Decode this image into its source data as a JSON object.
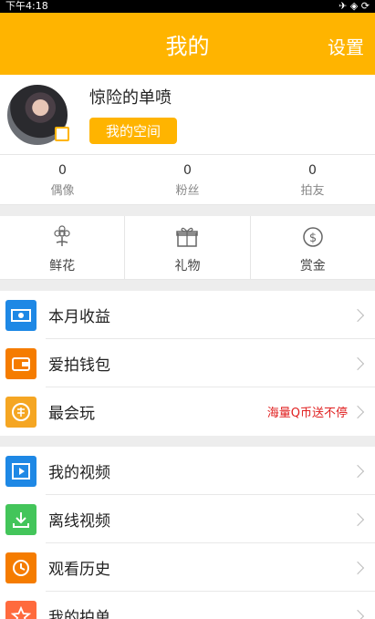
{
  "status": {
    "time": "下午4:18",
    "icons": "✈ ◈ ⟳"
  },
  "header": {
    "title": "我的",
    "settings": "设置"
  },
  "profile": {
    "name": "惊险的单喷",
    "space_button": "我的空间"
  },
  "stats": [
    {
      "value": "0",
      "label": "偶像"
    },
    {
      "value": "0",
      "label": "粉丝"
    },
    {
      "value": "0",
      "label": "拍友"
    }
  ],
  "gifts": [
    {
      "label": "鲜花",
      "icon": "flower-icon"
    },
    {
      "label": "礼物",
      "icon": "gift-icon"
    },
    {
      "label": "赏金",
      "icon": "coin-icon"
    }
  ],
  "menu1": [
    {
      "label": "本月收益",
      "icon": "income-icon",
      "color": "#1e88e5"
    },
    {
      "label": "爱拍钱包",
      "icon": "wallet-icon",
      "color": "#f57c00"
    },
    {
      "label": "最会玩",
      "icon": "medal-icon",
      "color": "#f5a623",
      "extra": "海量Q币送不停"
    }
  ],
  "menu2": [
    {
      "label": "我的视频",
      "icon": "video-icon",
      "color": "#1e88e5"
    },
    {
      "label": "离线视频",
      "icon": "download-icon",
      "color": "#43c55a"
    },
    {
      "label": "观看历史",
      "icon": "clock-icon",
      "color": "#f57c00"
    },
    {
      "label": "我的拍单",
      "icon": "star-icon",
      "color": "#ff6a3d"
    }
  ],
  "colors": {
    "accent": "#ffb400"
  }
}
